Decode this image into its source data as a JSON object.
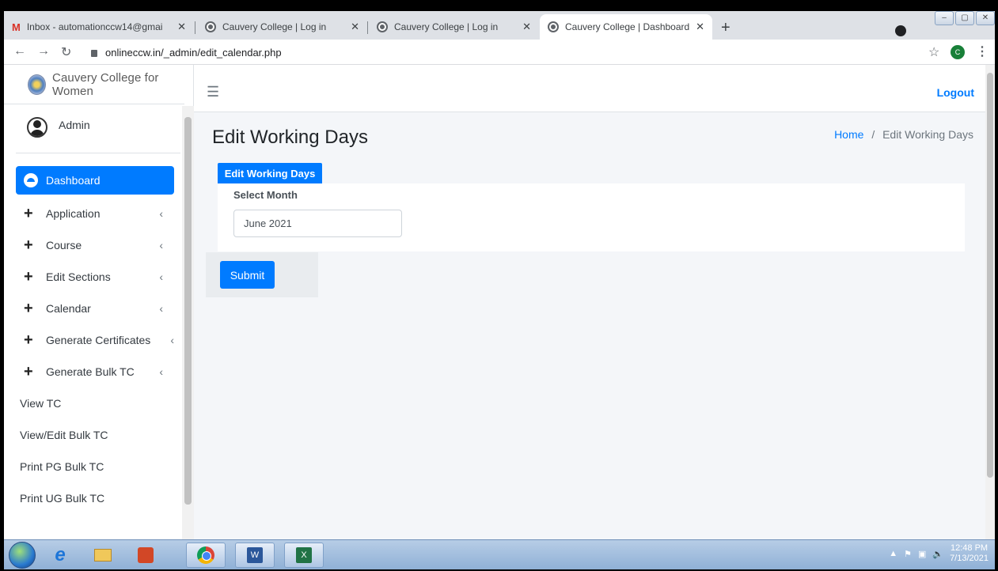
{
  "browser": {
    "tabs": [
      {
        "title": "Inbox - automationccw14@gmai",
        "icon": "gmail-icon"
      },
      {
        "title": "Cauvery College | Log in",
        "icon": "globe-icon"
      },
      {
        "title": "Cauvery College | Log in",
        "icon": "globe-icon"
      },
      {
        "title": "Cauvery College | Dashboard",
        "icon": "globe-icon",
        "active": true
      }
    ],
    "url": "onlineccw.in/_admin/edit_calendar.php",
    "profile_initial": "C"
  },
  "sidebar": {
    "brand": "Cauvery College for Women",
    "user": "Admin",
    "items": [
      {
        "label": "Dashboard",
        "active": true
      },
      {
        "label": "Application",
        "expandable": true
      },
      {
        "label": "Course",
        "expandable": true
      },
      {
        "label": "Edit Sections",
        "expandable": true
      },
      {
        "label": "Calendar",
        "expandable": true
      },
      {
        "label": "Generate Certificates",
        "expandable": true
      },
      {
        "label": "Generate Bulk TC",
        "expandable": true
      },
      {
        "label": "View TC"
      },
      {
        "label": "View/Edit Bulk TC"
      },
      {
        "label": "Print PG Bulk TC"
      },
      {
        "label": "Print UG Bulk TC"
      }
    ]
  },
  "header": {
    "logout": "Logout"
  },
  "page": {
    "title": "Edit Working Days",
    "breadcrumb": {
      "home": "Home",
      "sep": "/",
      "current": "Edit Working Days"
    },
    "card_tab": "Edit Working Days",
    "select_label": "Select Month",
    "month_value": "June 2021",
    "submit_label": "Submit"
  },
  "taskbar": {
    "time": "12:48 PM",
    "date": "7/13/2021"
  },
  "colors": {
    "accent": "#007bff"
  }
}
